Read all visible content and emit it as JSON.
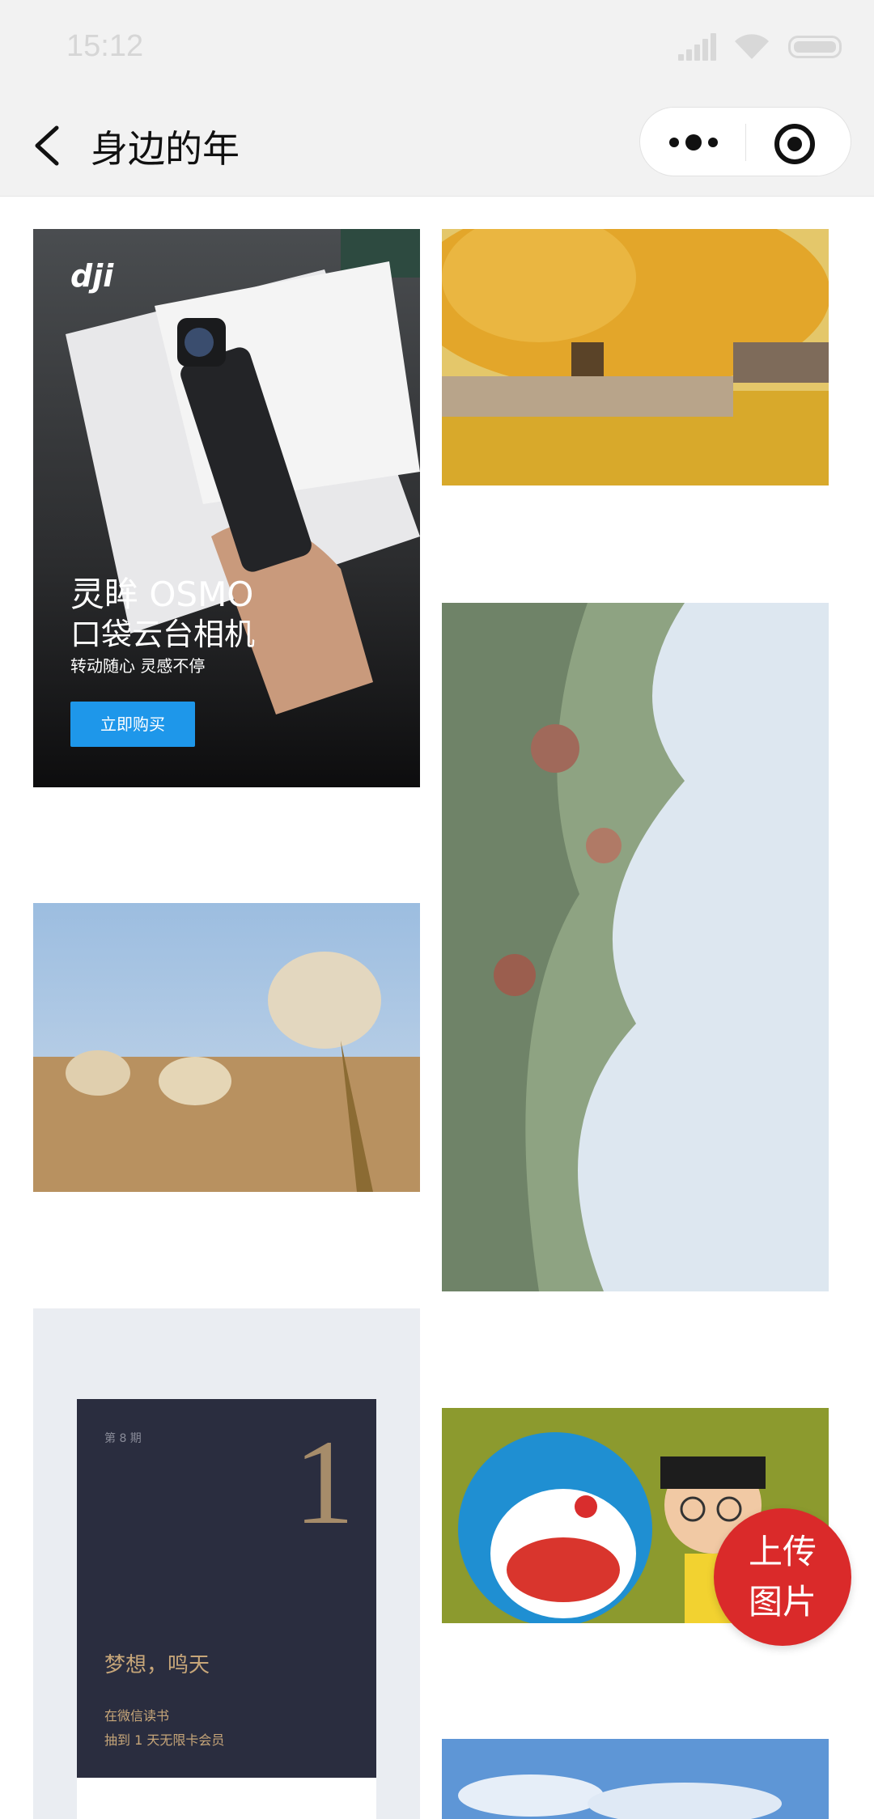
{
  "status_bar": {
    "time": "15:12"
  },
  "nav": {
    "title": "身边的年"
  },
  "ad": {
    "brand": "dji",
    "headline": "灵眸 OSMO",
    "subheadline": "口袋云台相机",
    "tagline": "转动随心 灵感不停",
    "button_label": "立即购买"
  },
  "poster": {
    "issue": "第 8 期",
    "number": "1",
    "title": "梦想，鸣天",
    "line1": "在微信读书",
    "line2": "抽到 1 天无限卡会员"
  },
  "fab": {
    "line1": "上传",
    "line2": "图片"
  },
  "colors": {
    "accent_red": "#da2a2a",
    "nav_bg": "#f2f2f2",
    "ad_button": "#1e97ea"
  },
  "icons": [
    "back-arrow-icon",
    "more-dots-icon",
    "close-target-icon",
    "signal-icon",
    "wifi-icon",
    "battery-icon"
  ]
}
